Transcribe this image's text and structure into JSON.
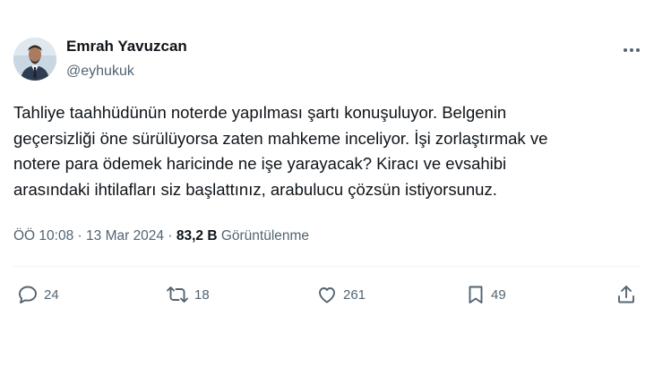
{
  "author": {
    "display_name": "Emrah Yavuzcan",
    "handle": "@eyhukuk"
  },
  "tweet": {
    "lines": [
      "Tahliye taahhüdünün noterde yapılması şartı konuşuluyor. Belgenin",
      "geçersizliği öne sürülüyorsa zaten mahkeme inceliyor. İşi zorlaştırmak ve",
      "notere para ödemek haricinde ne işe yarayacak? Kiracı ve evsahibi",
      "arasındaki ihtilafları siz başlattınız, arabulucu çözsün istiyorsunuz."
    ]
  },
  "meta": {
    "time": "ÖÖ 10:08",
    "separator": "·",
    "date": "13 Mar 2024",
    "views_count": "83,2 B",
    "views_label": "Görüntülenme"
  },
  "actions": {
    "replies": "24",
    "retweets": "18",
    "likes": "261",
    "bookmarks": "49"
  },
  "icons": {
    "more": "more-dots-icon",
    "reply": "reply-icon",
    "retweet": "retweet-icon",
    "like": "heart-icon",
    "bookmark": "bookmark-icon",
    "share": "share-icon"
  },
  "colors": {
    "text_primary": "#0f1419",
    "text_secondary": "#536471",
    "divider": "#eff3f4"
  }
}
